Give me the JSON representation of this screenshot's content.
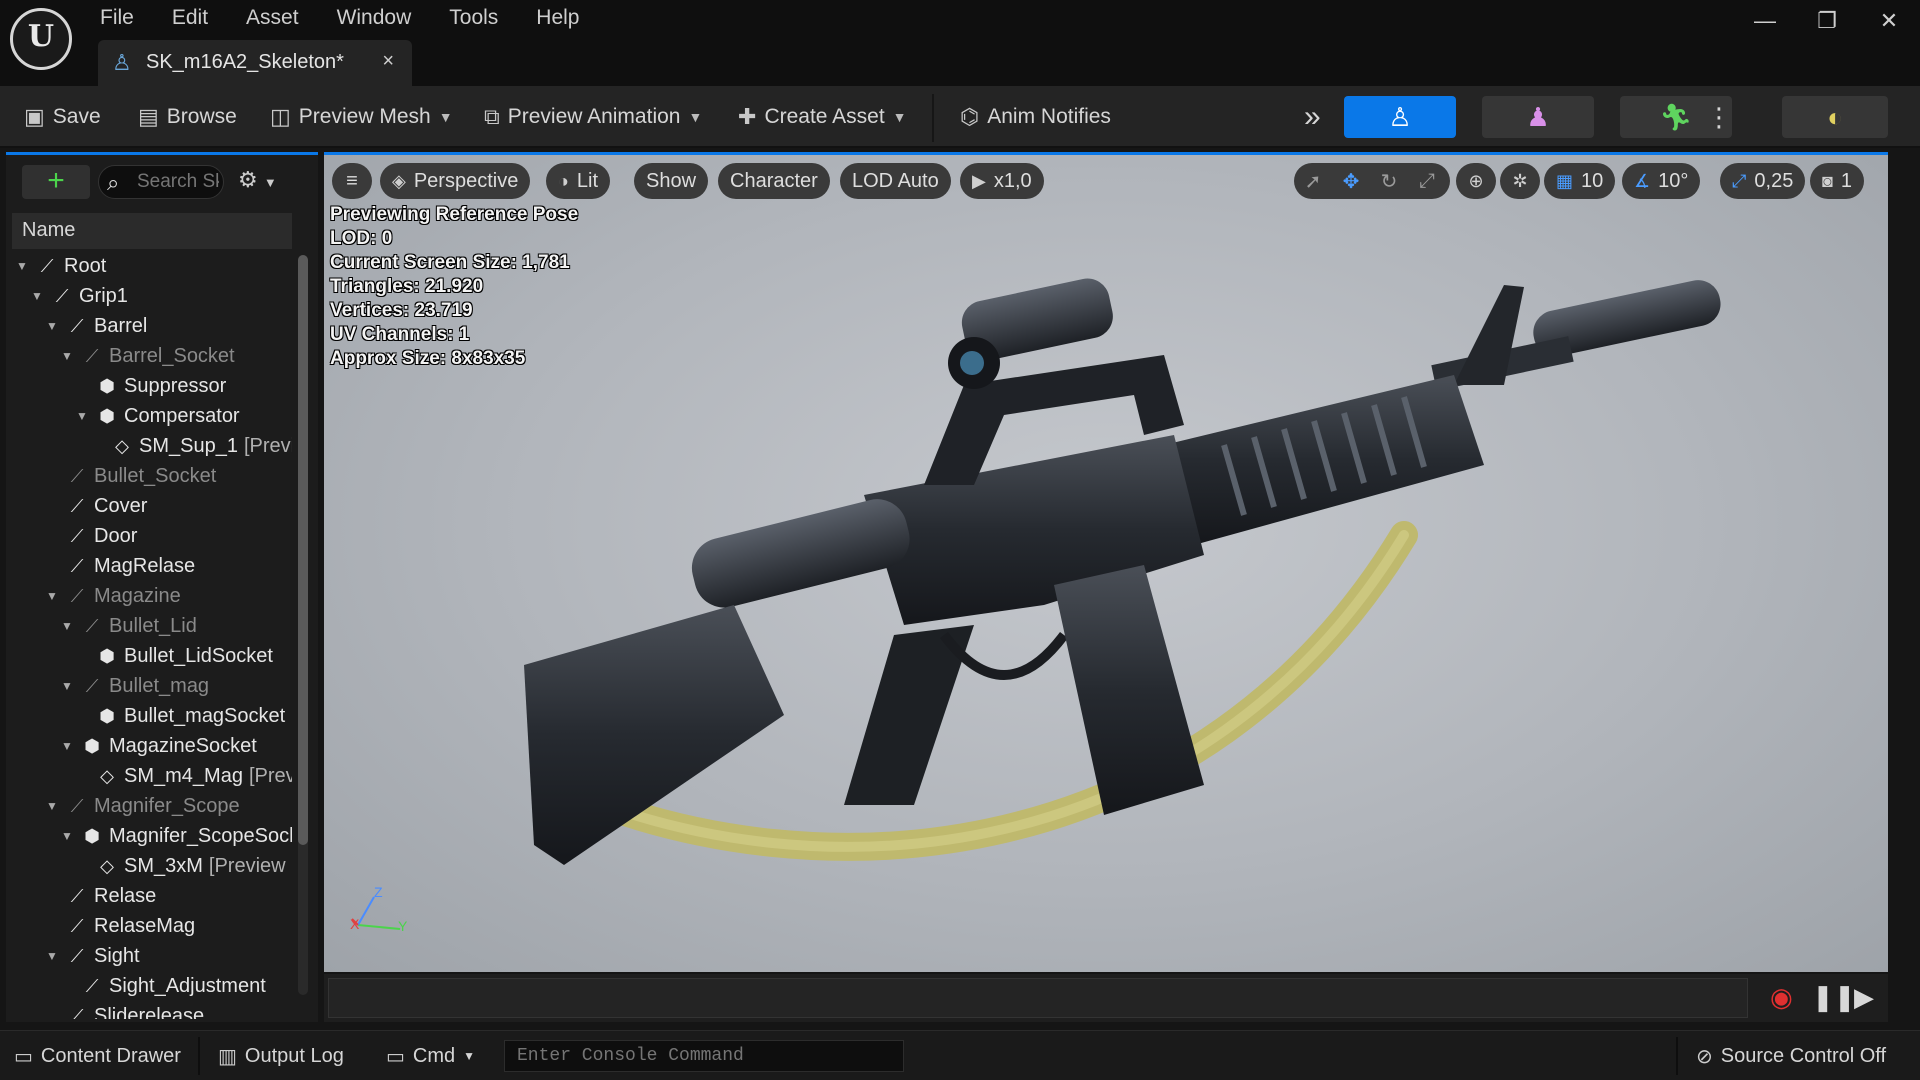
{
  "app": {
    "logo_text": "U"
  },
  "menu": [
    "File",
    "Edit",
    "Asset",
    "Window",
    "Tools",
    "Help"
  ],
  "tab": {
    "title": "SK_m16A2_Skeleton*",
    "close": "×"
  },
  "window_controls": {
    "minimize": "—",
    "restore": "❐",
    "close": "✕"
  },
  "toolbar": {
    "save": "Save",
    "browse": "Browse",
    "preview_mesh": "Preview Mesh",
    "preview_animation": "Preview Animation",
    "create_asset": "Create Asset",
    "anim_notifies": "Anim Notifies",
    "more": "»"
  },
  "left_panel": {
    "search_placeholder": "Search Skeleton Tree",
    "column_header": "Name",
    "tree": [
      {
        "label": "Root",
        "icon": "bone-icon",
        "depth": 0,
        "expanded": true,
        "dim": false,
        "suffix": ""
      },
      {
        "label": "Grip1",
        "icon": "bone-icon",
        "depth": 1,
        "expanded": true,
        "dim": false,
        "suffix": ""
      },
      {
        "label": "Barrel",
        "icon": "bone-icon",
        "depth": 2,
        "expanded": true,
        "dim": false,
        "suffix": ""
      },
      {
        "label": "Barrel_Socket",
        "icon": "bone-icon",
        "depth": 3,
        "expanded": true,
        "dim": true,
        "suffix": ""
      },
      {
        "label": "Suppressor",
        "icon": "socket-icon",
        "depth": 4,
        "expanded": null,
        "dim": false,
        "suffix": ""
      },
      {
        "label": "Compersator",
        "icon": "socket-icon",
        "depth": 4,
        "expanded": true,
        "dim": false,
        "suffix": ""
      },
      {
        "label": "SM_Sup_1",
        "icon": "mesh-icon",
        "depth": 5,
        "expanded": null,
        "dim": false,
        "suffix": "[Previ"
      },
      {
        "label": "Bullet_Socket",
        "icon": "bone-icon",
        "depth": 2,
        "expanded": null,
        "dim": true,
        "suffix": ""
      },
      {
        "label": "Cover",
        "icon": "bone-icon",
        "depth": 2,
        "expanded": null,
        "dim": false,
        "suffix": ""
      },
      {
        "label": "Door",
        "icon": "bone-icon",
        "depth": 2,
        "expanded": null,
        "dim": false,
        "suffix": ""
      },
      {
        "label": "MagRelase",
        "icon": "bone-icon",
        "depth": 2,
        "expanded": null,
        "dim": false,
        "suffix": ""
      },
      {
        "label": "Magazine",
        "icon": "bone-icon",
        "depth": 2,
        "expanded": true,
        "dim": true,
        "suffix": ""
      },
      {
        "label": "Bullet_Lid",
        "icon": "bone-icon",
        "depth": 3,
        "expanded": true,
        "dim": true,
        "suffix": ""
      },
      {
        "label": "Bullet_LidSocket",
        "icon": "socket-icon",
        "depth": 4,
        "expanded": null,
        "dim": false,
        "suffix": ""
      },
      {
        "label": "Bullet_mag",
        "icon": "bone-icon",
        "depth": 3,
        "expanded": true,
        "dim": true,
        "suffix": ""
      },
      {
        "label": "Bullet_magSocket",
        "icon": "socket-icon",
        "depth": 4,
        "expanded": null,
        "dim": false,
        "suffix": ""
      },
      {
        "label": "MagazineSocket",
        "icon": "socket-icon",
        "depth": 3,
        "expanded": true,
        "dim": false,
        "suffix": ""
      },
      {
        "label": "SM_m4_Mag",
        "icon": "mesh-icon",
        "depth": 4,
        "expanded": null,
        "dim": false,
        "suffix": "[Prev"
      },
      {
        "label": "Magnifer_Scope",
        "icon": "bone-icon",
        "depth": 2,
        "expanded": true,
        "dim": true,
        "suffix": ""
      },
      {
        "label": "Magnifer_ScopeSocl",
        "icon": "socket-icon",
        "depth": 3,
        "expanded": true,
        "dim": false,
        "suffix": ""
      },
      {
        "label": "SM_3xM",
        "icon": "mesh-icon",
        "depth": 4,
        "expanded": null,
        "dim": false,
        "suffix": "[Preview ("
      },
      {
        "label": "Relase",
        "icon": "bone-icon",
        "depth": 2,
        "expanded": null,
        "dim": false,
        "suffix": ""
      },
      {
        "label": "RelaseMag",
        "icon": "bone-icon",
        "depth": 2,
        "expanded": null,
        "dim": false,
        "suffix": ""
      },
      {
        "label": "Sight",
        "icon": "bone-icon",
        "depth": 2,
        "expanded": true,
        "dim": false,
        "suffix": ""
      },
      {
        "label": "Sight_Adjustment",
        "icon": "bone-icon",
        "depth": 3,
        "expanded": null,
        "dim": false,
        "suffix": ""
      },
      {
        "label": "Sliderelease",
        "icon": "bone-icon",
        "depth": 2,
        "expanded": null,
        "dim": false,
        "suffix": ""
      }
    ]
  },
  "viewport": {
    "menu_icon": "≡",
    "perspective": "Perspective",
    "lit": "Lit",
    "show": "Show",
    "character": "Character",
    "lod": "LOD Auto",
    "play_speed": "x1,0",
    "grid_snap": "10",
    "rotation_snap": "10°",
    "scale_snap": "0,25",
    "camera_speed": "1",
    "overlay": [
      "Previewing Reference Pose",
      "LOD: 0",
      "Current Screen Size: 1,781",
      "Triangles: 21.920",
      "Vertices: 23.719",
      "UV Channels: 1",
      "Approx Size: 8x83x35"
    ],
    "axis": {
      "x": "X",
      "y": "Y",
      "z": "Z"
    },
    "colors": {
      "accent": "#0a78e8",
      "sling": "#c9c37a"
    }
  },
  "statusbar": {
    "content_drawer": "Content Drawer",
    "output_log": "Output Log",
    "cmd": "Cmd",
    "console_placeholder": "Enter Console Command",
    "source_control": "Source Control Off"
  }
}
